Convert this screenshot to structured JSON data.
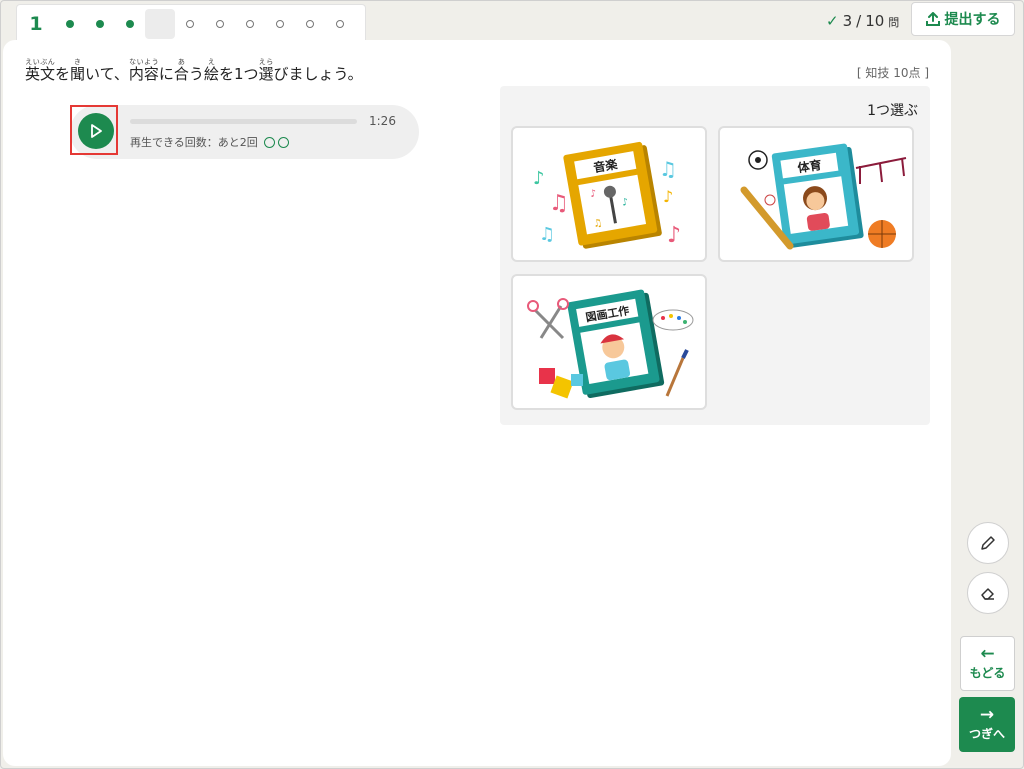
{
  "nav": {
    "current_question": "1",
    "dots": [
      "done",
      "done",
      "done",
      "current",
      "todo",
      "todo",
      "todo",
      "todo",
      "todo",
      "todo"
    ]
  },
  "progress": {
    "answered": "3",
    "separator": "/",
    "total": "10",
    "unit": "問"
  },
  "submit": {
    "label": "提出する",
    "icon": "upload-icon"
  },
  "question": {
    "parts": [
      {
        "base": "英文",
        "ruby": "えいぶん"
      },
      {
        "text": "を"
      },
      {
        "base": "聞",
        "ruby": "き"
      },
      {
        "text": "いて、"
      },
      {
        "base": "内容",
        "ruby": "ないよう"
      },
      {
        "text": "に"
      },
      {
        "base": "合",
        "ruby": "あ"
      },
      {
        "text": "う"
      },
      {
        "base": "絵",
        "ruby": "え"
      },
      {
        "text": "を1つ"
      },
      {
        "base": "選",
        "ruby": "えら"
      },
      {
        "text": "びましょう。"
      }
    ],
    "points": "[ 知技 10点 ]"
  },
  "player": {
    "time": "1:26",
    "remaining_text": "再生できる回数：あと2回",
    "remaining_plays": 2,
    "progress": 0
  },
  "choices": {
    "label": "1つ選ぶ",
    "items": [
      {
        "book_title": "音楽",
        "icon": "music-book-illustration"
      },
      {
        "book_title": "体育",
        "icon": "pe-book-illustration"
      },
      {
        "book_title": "図画工作",
        "icon": "art-book-illustration"
      }
    ]
  },
  "tools": {
    "pen": "pencil-icon",
    "eraser": "eraser-icon"
  },
  "footer": {
    "back_label": "もどる",
    "next_label": "つぎへ"
  },
  "colors": {
    "accent": "#1d8a4f",
    "highlight": "#e53935",
    "book_music": "#e5a600",
    "book_pe": "#3bb7c9",
    "book_art": "#1b9a8e"
  }
}
